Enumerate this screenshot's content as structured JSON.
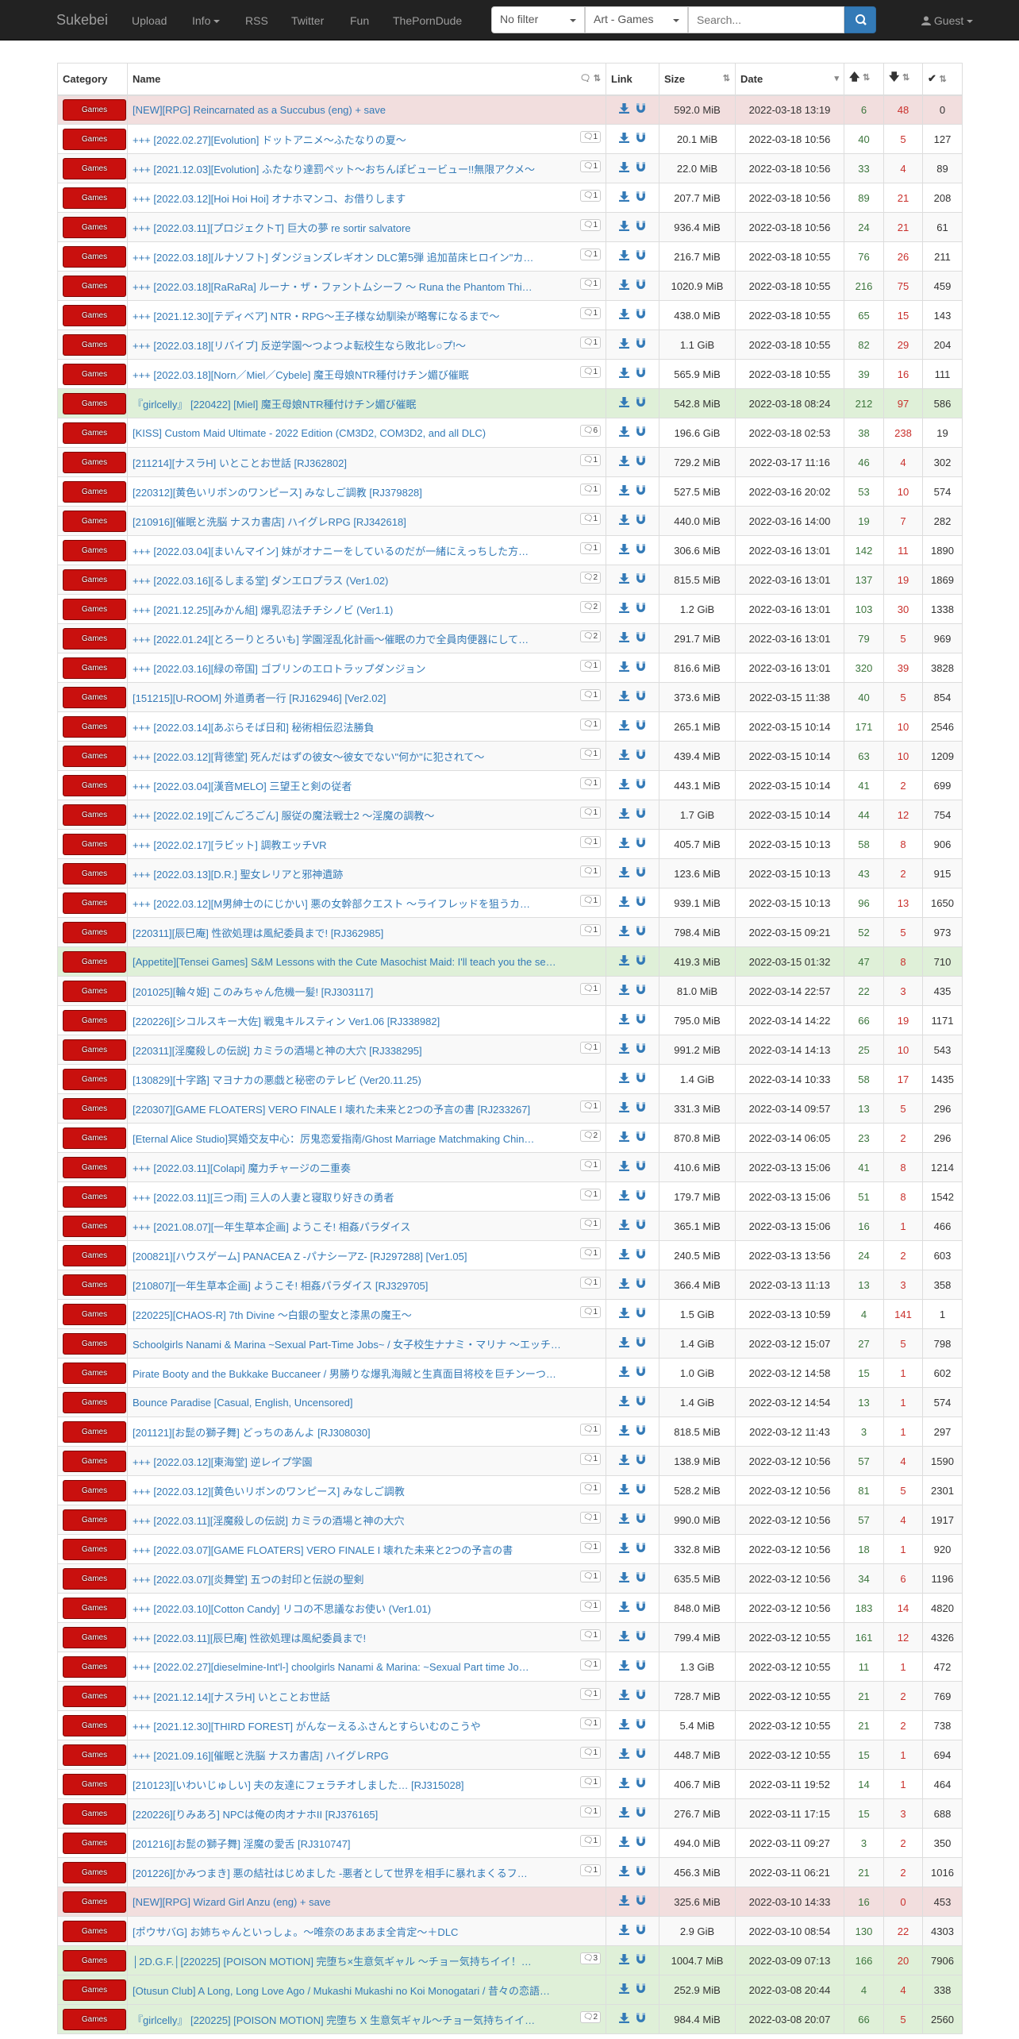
{
  "nav": {
    "brand": "Sukebei",
    "upload": "Upload",
    "info": "Info",
    "rss": "RSS",
    "twitter": "Twitter",
    "fun": "Fun",
    "pornduDe": "ThePornDude",
    "filter": "No filter",
    "category": "Art - Games",
    "search_placeholder": "Search...",
    "guest": "Guest"
  },
  "table": {
    "headers": {
      "category": "Category",
      "name": "Name",
      "link": "Link",
      "size": "Size",
      "date": "Date"
    },
    "category_badge": "Games",
    "rows": [
      {
        "name": "[NEW][RPG] Reincarnated as a Succubus (eng) + save",
        "comments": "",
        "size": "592.0 MiB",
        "date": "2022-03-18 13:19",
        "seeders": "6",
        "leechers": "48",
        "completed": "0",
        "status": "danger"
      },
      {
        "name": "+++ [2022.02.27][Evolution] ドットアニメ～ふたなりの夏～",
        "comments": "1",
        "size": "20.1 MiB",
        "date": "2022-03-18 10:56",
        "seeders": "40",
        "leechers": "5",
        "completed": "127",
        "status": "default"
      },
      {
        "name": "+++ [2021.12.03][Evolution] ふたなり達罰ペット～おちんぽビュービュー!!無限アクメ～",
        "comments": "1",
        "size": "22.0 MiB",
        "date": "2022-03-18 10:56",
        "seeders": "33",
        "leechers": "4",
        "completed": "89",
        "status": "default"
      },
      {
        "name": "+++ [2022.03.12][Hoi Hoi Hoi] オナホマンコ、お借りします",
        "comments": "1",
        "size": "207.7 MiB",
        "date": "2022-03-18 10:56",
        "seeders": "89",
        "leechers": "21",
        "completed": "208",
        "status": "default"
      },
      {
        "name": "+++ [2022.03.11][プロジェクトT] 巨大の夢 re sortir salvatore",
        "comments": "1",
        "size": "936.4 MiB",
        "date": "2022-03-18 10:56",
        "seeders": "24",
        "leechers": "21",
        "completed": "61",
        "status": "default"
      },
      {
        "name": "+++ [2022.03.18][ルナソフト] ダンジョンズレギオン DLC第5弾 追加苗床ヒロイン\"カ…",
        "comments": "1",
        "size": "216.7 MiB",
        "date": "2022-03-18 10:55",
        "seeders": "76",
        "leechers": "26",
        "completed": "211",
        "status": "default"
      },
      {
        "name": "+++ [2022.03.18][RaRaRa] ルーナ・ザ・ファントムシーフ ～ Runa the Phantom Thi…",
        "comments": "1",
        "size": "1020.9 MiB",
        "date": "2022-03-18 10:55",
        "seeders": "216",
        "leechers": "75",
        "completed": "459",
        "status": "default"
      },
      {
        "name": "+++ [2021.12.30][テディベア] NTR・RPG～王子様な幼馴染が略奪になるまで～",
        "comments": "1",
        "size": "438.0 MiB",
        "date": "2022-03-18 10:55",
        "seeders": "65",
        "leechers": "15",
        "completed": "143",
        "status": "default"
      },
      {
        "name": "+++ [2022.03.18][リバイブ] 反逆学園～つよつよ転校生なら敗北レ○プ!～",
        "comments": "1",
        "size": "1.1 GiB",
        "date": "2022-03-18 10:55",
        "seeders": "82",
        "leechers": "29",
        "completed": "204",
        "status": "default"
      },
      {
        "name": "+++ [2022.03.18][Norn／Miel／Cybele] 魔王母娘NTR種付けチン媚び催眠",
        "comments": "1",
        "size": "565.9 MiB",
        "date": "2022-03-18 10:55",
        "seeders": "39",
        "leechers": "16",
        "completed": "111",
        "status": "default"
      },
      {
        "name": "『girlcelly』 [220422] [Miel] 魔王母娘NTR種付けチン媚び催眠",
        "comments": "",
        "size": "542.8 MiB",
        "date": "2022-03-18 08:24",
        "seeders": "212",
        "leechers": "97",
        "completed": "586",
        "status": "success"
      },
      {
        "name": "[KISS] Custom Maid Ultimate - 2022 Edition (CM3D2, COM3D2, and all DLC)",
        "comments": "6",
        "size": "196.6 GiB",
        "date": "2022-03-18 02:53",
        "seeders": "38",
        "leechers": "238",
        "completed": "19",
        "status": "default"
      },
      {
        "name": "[211214][ナスラH] いとことお世話 [RJ362802]",
        "comments": "1",
        "size": "729.2 MiB",
        "date": "2022-03-17 11:16",
        "seeders": "46",
        "leechers": "4",
        "completed": "302",
        "status": "default"
      },
      {
        "name": "[220312][黄色いリボンのワンピース] みなしご調教 [RJ379828]",
        "comments": "1",
        "size": "527.5 MiB",
        "date": "2022-03-16 20:02",
        "seeders": "53",
        "leechers": "10",
        "completed": "574",
        "status": "default"
      },
      {
        "name": "[210916][催眠と洗脳 ナスカ書店] ハイグレRPG [RJ342618]",
        "comments": "1",
        "size": "440.0 MiB",
        "date": "2022-03-16 14:00",
        "seeders": "19",
        "leechers": "7",
        "completed": "282",
        "status": "default"
      },
      {
        "name": "+++ [2022.03.04][まいんマイン] 妹がオナニーをしているのだが一緒にえっちした方…",
        "comments": "1",
        "size": "306.6 MiB",
        "date": "2022-03-16 13:01",
        "seeders": "142",
        "leechers": "11",
        "completed": "1890",
        "status": "default"
      },
      {
        "name": "+++ [2022.03.16][るしまる堂] ダンエロプラス (Ver1.02)",
        "comments": "2",
        "size": "815.5 MiB",
        "date": "2022-03-16 13:01",
        "seeders": "137",
        "leechers": "19",
        "completed": "1869",
        "status": "default"
      },
      {
        "name": "+++ [2021.12.25][みかん組] 爆乳忍法チチシノビ (Ver1.1)",
        "comments": "2",
        "size": "1.2 GiB",
        "date": "2022-03-16 13:01",
        "seeders": "103",
        "leechers": "30",
        "completed": "1338",
        "status": "default"
      },
      {
        "name": "+++ [2022.01.24][とろーりとろいも] 学園淫乱化計画～催眠の力で全員肉便器にして…",
        "comments": "2",
        "size": "291.7 MiB",
        "date": "2022-03-16 13:01",
        "seeders": "79",
        "leechers": "5",
        "completed": "969",
        "status": "default"
      },
      {
        "name": "+++ [2022.03.16][緑の帝国] ゴブリンのエロトラップダンジョン",
        "comments": "1",
        "size": "816.6 MiB",
        "date": "2022-03-16 13:01",
        "seeders": "320",
        "leechers": "39",
        "completed": "3828",
        "status": "default"
      },
      {
        "name": "[151215][U-ROOM] 外道勇者一行 [RJ162946] [Ver2.02]",
        "comments": "1",
        "size": "373.6 MiB",
        "date": "2022-03-15 11:38",
        "seeders": "40",
        "leechers": "5",
        "completed": "854",
        "status": "default"
      },
      {
        "name": "+++ [2022.03.14][あぶらそば日和] 秘術相伝忍法勝負",
        "comments": "1",
        "size": "265.1 MiB",
        "date": "2022-03-15 10:14",
        "seeders": "171",
        "leechers": "10",
        "completed": "2546",
        "status": "default"
      },
      {
        "name": "+++ [2022.03.12][背徳堂] 死んだはずの彼女～彼女でない\"何か\"に犯されて～",
        "comments": "1",
        "size": "439.4 MiB",
        "date": "2022-03-15 10:14",
        "seeders": "63",
        "leechers": "10",
        "completed": "1209",
        "status": "default"
      },
      {
        "name": "+++ [2022.03.04][漢音MELO] 三望王と剣の従者",
        "comments": "1",
        "size": "443.1 MiB",
        "date": "2022-03-15 10:14",
        "seeders": "41",
        "leechers": "2",
        "completed": "699",
        "status": "default"
      },
      {
        "name": "+++ [2022.02.19][ごんごろごん] 服従の魔法戦士2 ～淫魔の調教～",
        "comments": "1",
        "size": "1.7 GiB",
        "date": "2022-03-15 10:14",
        "seeders": "44",
        "leechers": "12",
        "completed": "754",
        "status": "default"
      },
      {
        "name": "+++ [2022.02.17][ラビット] 調教エッチVR",
        "comments": "1",
        "size": "405.7 MiB",
        "date": "2022-03-15 10:13",
        "seeders": "58",
        "leechers": "8",
        "completed": "906",
        "status": "default"
      },
      {
        "name": "+++ [2022.03.13][D.R.] 聖女レリアと邪神遺跡",
        "comments": "1",
        "size": "123.6 MiB",
        "date": "2022-03-15 10:13",
        "seeders": "43",
        "leechers": "2",
        "completed": "915",
        "status": "default"
      },
      {
        "name": "+++ [2022.03.12][M男紳士のにじかい] 悪の女幹部クエスト ～ライフレッドを狙うカ…",
        "comments": "1",
        "size": "939.1 MiB",
        "date": "2022-03-15 10:13",
        "seeders": "96",
        "leechers": "13",
        "completed": "1650",
        "status": "default"
      },
      {
        "name": "[220311][辰巳庵] 性欲処理は風紀委員まで! [RJ362985]",
        "comments": "1",
        "size": "798.4 MiB",
        "date": "2022-03-15 09:21",
        "seeders": "52",
        "leechers": "5",
        "completed": "973",
        "status": "default"
      },
      {
        "name": "[Appetite][Tensei Games] S&M Lessons with the Cute Masochist Maid: I'll teach you the se…",
        "comments": "",
        "size": "419.3 MiB",
        "date": "2022-03-15 01:32",
        "seeders": "47",
        "leechers": "8",
        "completed": "710",
        "status": "success"
      },
      {
        "name": "[201025][輪々姫] このみちゃん危機一髪! [RJ303117]",
        "comments": "1",
        "size": "81.0 MiB",
        "date": "2022-03-14 22:57",
        "seeders": "22",
        "leechers": "3",
        "completed": "435",
        "status": "default"
      },
      {
        "name": "[220226][シコルスキー大佐] 戦鬼キルスティン Ver1.06 [RJ338982]",
        "comments": "",
        "size": "795.0 MiB",
        "date": "2022-03-14 14:22",
        "seeders": "66",
        "leechers": "19",
        "completed": "1171",
        "status": "default"
      },
      {
        "name": "[220311][淫魔殺しの伝説] カミラの酒場と神の大穴 [RJ338295]",
        "comments": "1",
        "size": "991.2 MiB",
        "date": "2022-03-14 14:13",
        "seeders": "25",
        "leechers": "10",
        "completed": "543",
        "status": "default"
      },
      {
        "name": "[130829][十字路] マヨナカの悪戯と秘密のテレビ (Ver20.11.25)",
        "comments": "",
        "size": "1.4 GiB",
        "date": "2022-03-14 10:33",
        "seeders": "58",
        "leechers": "17",
        "completed": "1435",
        "status": "default"
      },
      {
        "name": "[220307][GAME FLOATERS] VERO FINALE I 壊れた未来と2つの予言の書 [RJ233267]",
        "comments": "1",
        "size": "331.3 MiB",
        "date": "2022-03-14 09:57",
        "seeders": "13",
        "leechers": "5",
        "completed": "296",
        "status": "default"
      },
      {
        "name": "[Eternal Alice Studio]冥婚交友中心：厉鬼恋爱指南/Ghost Marriage Matchmaking Chin…",
        "comments": "2",
        "size": "870.8 MiB",
        "date": "2022-03-14 06:05",
        "seeders": "23",
        "leechers": "2",
        "completed": "296",
        "status": "default"
      },
      {
        "name": "+++ [2022.03.11][Colapi] 魔力チャージの二重奏",
        "comments": "1",
        "size": "410.6 MiB",
        "date": "2022-03-13 15:06",
        "seeders": "41",
        "leechers": "8",
        "completed": "1214",
        "status": "default"
      },
      {
        "name": "+++ [2022.03.11][三つ雨] 三人の人妻と寝取り好きの勇者",
        "comments": "1",
        "size": "179.7 MiB",
        "date": "2022-03-13 15:06",
        "seeders": "51",
        "leechers": "8",
        "completed": "1542",
        "status": "default"
      },
      {
        "name": "+++ [2021.08.07][一年生草本企画] ようこそ! 相姦パラダイス",
        "comments": "1",
        "size": "365.1 MiB",
        "date": "2022-03-13 15:06",
        "seeders": "16",
        "leechers": "1",
        "completed": "466",
        "status": "default"
      },
      {
        "name": "[200821][ハウスゲーム] PANACEA Z -パナシーアZ- [RJ297288] [Ver1.05]",
        "comments": "1",
        "size": "240.5 MiB",
        "date": "2022-03-13 13:56",
        "seeders": "24",
        "leechers": "2",
        "completed": "603",
        "status": "default"
      },
      {
        "name": "[210807][一年生草本企画] ようこそ! 相姦パラダイス [RJ329705]",
        "comments": "1",
        "size": "366.4 MiB",
        "date": "2022-03-13 11:13",
        "seeders": "13",
        "leechers": "3",
        "completed": "358",
        "status": "default"
      },
      {
        "name": "[220225][CHAOS-R] 7th Divine ～白銀の聖女と漆黒の魔王～",
        "comments": "1",
        "size": "1.5 GiB",
        "date": "2022-03-13 10:59",
        "seeders": "4",
        "leechers": "141",
        "completed": "1",
        "status": "default"
      },
      {
        "name": "Schoolgirls Nanami & Marina ~Sexual Part-Time Jobs~ / 女子校生ナナミ・マリナ ～エッチ…",
        "comments": "",
        "size": "1.4 GiB",
        "date": "2022-03-12 15:07",
        "seeders": "27",
        "leechers": "5",
        "completed": "798",
        "status": "default"
      },
      {
        "name": "Pirate Booty and the Bukkake Buccaneer / 男勝りな爆乳海賊と生真面目将校を巨チンーつ…",
        "comments": "",
        "size": "1.0 GiB",
        "date": "2022-03-12 14:58",
        "seeders": "15",
        "leechers": "1",
        "completed": "602",
        "status": "default"
      },
      {
        "name": "Bounce Paradise [Casual, English, Uncensored]",
        "comments": "",
        "size": "1.4 GiB",
        "date": "2022-03-12 14:54",
        "seeders": "13",
        "leechers": "1",
        "completed": "574",
        "status": "default"
      },
      {
        "name": "[201121][お髭の獅子舞] どっちのあんよ [RJ308030]",
        "comments": "1",
        "size": "818.5 MiB",
        "date": "2022-03-12 11:43",
        "seeders": "3",
        "leechers": "1",
        "completed": "297",
        "status": "default"
      },
      {
        "name": "+++ [2022.03.12][東海堂] 逆レイプ学園",
        "comments": "1",
        "size": "138.9 MiB",
        "date": "2022-03-12 10:56",
        "seeders": "57",
        "leechers": "4",
        "completed": "1590",
        "status": "default"
      },
      {
        "name": "+++ [2022.03.12][黄色いリボンのワンピース] みなしご調教",
        "comments": "1",
        "size": "528.2 MiB",
        "date": "2022-03-12 10:56",
        "seeders": "81",
        "leechers": "5",
        "completed": "2301",
        "status": "default"
      },
      {
        "name": "+++ [2022.03.11][淫魔殺しの伝説] カミラの酒場と神の大穴",
        "comments": "1",
        "size": "990.0 MiB",
        "date": "2022-03-12 10:56",
        "seeders": "57",
        "leechers": "4",
        "completed": "1917",
        "status": "default"
      },
      {
        "name": "+++ [2022.03.07][GAME FLOATERS] VERO FINALE I 壊れた未来と2つの予言の書",
        "comments": "1",
        "size": "332.8 MiB",
        "date": "2022-03-12 10:56",
        "seeders": "18",
        "leechers": "1",
        "completed": "920",
        "status": "default"
      },
      {
        "name": "+++ [2022.03.07][炎舞堂] 五つの封印と伝説の聖剣",
        "comments": "1",
        "size": "635.5 MiB",
        "date": "2022-03-12 10:56",
        "seeders": "34",
        "leechers": "6",
        "completed": "1196",
        "status": "default"
      },
      {
        "name": "+++ [2022.03.10][Cotton Candy] リコの不思議なお使い (Ver1.01)",
        "comments": "1",
        "size": "848.0 MiB",
        "date": "2022-03-12 10:56",
        "seeders": "183",
        "leechers": "14",
        "completed": "4820",
        "status": "default"
      },
      {
        "name": "+++ [2022.03.11][辰巳庵] 性欲処理は風紀委員まで!",
        "comments": "1",
        "size": "799.4 MiB",
        "date": "2022-03-12 10:55",
        "seeders": "161",
        "leechers": "12",
        "completed": "4326",
        "status": "default"
      },
      {
        "name": "+++ [2022.02.27][dieselmine-Int'l-] choolgirls Nanami & Marina: ~Sexual Part time Jo…",
        "comments": "1",
        "size": "1.3 GiB",
        "date": "2022-03-12 10:55",
        "seeders": "11",
        "leechers": "1",
        "completed": "472",
        "status": "default"
      },
      {
        "name": "+++ [2021.12.14][ナスラH] いとことお世話",
        "comments": "1",
        "size": "728.7 MiB",
        "date": "2022-03-12 10:55",
        "seeders": "21",
        "leechers": "2",
        "completed": "769",
        "status": "default"
      },
      {
        "name": "+++ [2021.12.30][THIRD FOREST] がんなーえるふさんとすらいむのこうや",
        "comments": "1",
        "size": "5.4 MiB",
        "date": "2022-03-12 10:55",
        "seeders": "21",
        "leechers": "2",
        "completed": "738",
        "status": "default"
      },
      {
        "name": "+++ [2021.09.16][催眠と洗脳 ナスカ書店] ハイグレRPG",
        "comments": "1",
        "size": "448.7 MiB",
        "date": "2022-03-12 10:55",
        "seeders": "15",
        "leechers": "1",
        "completed": "694",
        "status": "default"
      },
      {
        "name": "[210123][いわいじゅしい] 夫の友達にフェラチオしました… [RJ315028]",
        "comments": "1",
        "size": "406.7 MiB",
        "date": "2022-03-11 19:52",
        "seeders": "14",
        "leechers": "1",
        "completed": "464",
        "status": "default"
      },
      {
        "name": "[220226][りみあろ] NPCは俺の肉オナホII [RJ376165]",
        "comments": "1",
        "size": "276.7 MiB",
        "date": "2022-03-11 17:15",
        "seeders": "15",
        "leechers": "3",
        "completed": "688",
        "status": "default"
      },
      {
        "name": "[201216][お髭の獅子舞] 淫魔の愛舌 [RJ310747]",
        "comments": "1",
        "size": "494.0 MiB",
        "date": "2022-03-11 09:27",
        "seeders": "3",
        "leechers": "2",
        "completed": "350",
        "status": "default"
      },
      {
        "name": "[201226][かみつまき] 悪の結社はじめました -悪者として世界を相手に暴れまくるフ…",
        "comments": "1",
        "size": "456.3 MiB",
        "date": "2022-03-11 06:21",
        "seeders": "21",
        "leechers": "2",
        "completed": "1016",
        "status": "default"
      },
      {
        "name": "[NEW][RPG] Wizard Girl Anzu (eng) + save",
        "comments": "",
        "size": "325.6 MiB",
        "date": "2022-03-10 14:33",
        "seeders": "16",
        "leechers": "0",
        "completed": "453",
        "status": "danger"
      },
      {
        "name": "[ポウサバG] お姉ちゃんといっしょ。～唯奈のあまあま全肯定～＋DLC",
        "comments": "",
        "size": "2.9 GiB",
        "date": "2022-03-10 08:54",
        "seeders": "130",
        "leechers": "22",
        "completed": "4303",
        "status": "default"
      },
      {
        "name": "│2D.G.F.│[220225] [POISON MOTION] 完堕ち×生意気ギャル ～チョー気持ちイイ！…",
        "comments": "3",
        "size": "1004.7 MiB",
        "date": "2022-03-09 07:13",
        "seeders": "166",
        "leechers": "20",
        "completed": "7906",
        "status": "success"
      },
      {
        "name": "[Otusun Club] A Long, Long Love Ago / Mukashi Mukashi no Koi Monogatari / 昔々の恋語…",
        "comments": "",
        "size": "252.9 MiB",
        "date": "2022-03-08 20:44",
        "seeders": "4",
        "leechers": "4",
        "completed": "338",
        "status": "success"
      },
      {
        "name": "『girlcelly』 [220225] [POISON MOTION] 完堕ち X 生意気ギャル～チョー気持ちイイ…",
        "comments": "2",
        "size": "984.4 MiB",
        "date": "2022-03-08 20:07",
        "seeders": "66",
        "leechers": "5",
        "completed": "2560",
        "status": "success"
      }
    ]
  }
}
